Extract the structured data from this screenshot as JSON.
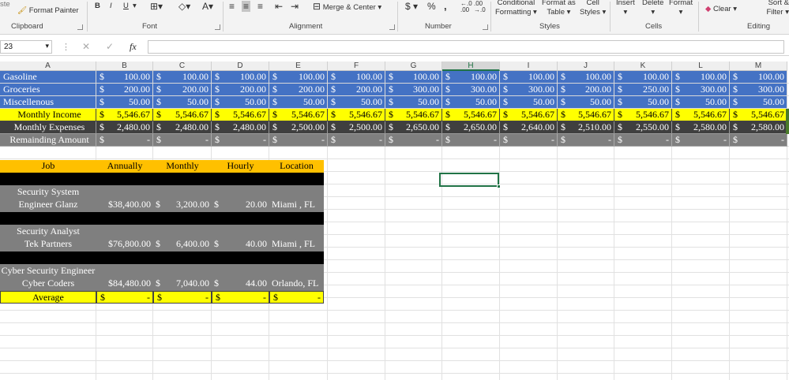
{
  "ribbon": {
    "paste_fragment": "ste",
    "format_painter": "Format Painter",
    "bold": "B",
    "italic": "I",
    "underline": "U",
    "font_color_glyph": "A",
    "merge_center": "Merge & Center",
    "currency": "$",
    "percent": "%",
    "comma": ",",
    "conditional_formatting_1": "Conditional",
    "conditional_formatting_2": "Formatting",
    "format_as_table_1": "Format as",
    "format_as_table_2": "Table",
    "cell_styles_1": "Cell",
    "cell_styles_2": "Styles",
    "insert": "Insert",
    "delete": "Delete",
    "format": "Format",
    "clear": "Clear",
    "sort_filter_1": "Sort &",
    "sort_filter_2": "Filter",
    "groups": {
      "clipboard": "Clipboard",
      "font": "Font",
      "alignment": "Alignment",
      "number": "Number",
      "styles": "Styles",
      "cells": "Cells",
      "editing": "Editing"
    }
  },
  "formula_bar": {
    "name_box": "23",
    "fx": "fx",
    "cancel": "✕",
    "enter": "✓",
    "value": ""
  },
  "columns": [
    "A",
    "B",
    "C",
    "D",
    "E",
    "F",
    "G",
    "H",
    "I",
    "J",
    "K",
    "L",
    "M"
  ],
  "selected_column": "H",
  "budget": {
    "rows": [
      {
        "label": "Gasoline",
        "style": "blue",
        "values": [
          "100.00",
          "100.00",
          "100.00",
          "100.00",
          "100.00",
          "100.00",
          "100.00",
          "100.00",
          "100.00",
          "100.00",
          "100.00",
          "100.00"
        ]
      },
      {
        "label": "Groceries",
        "style": "blue",
        "values": [
          "200.00",
          "200.00",
          "200.00",
          "200.00",
          "200.00",
          "300.00",
          "300.00",
          "300.00",
          "200.00",
          "250.00",
          "300.00",
          "300.00"
        ]
      },
      {
        "label": "Miscellenous",
        "style": "blue",
        "values": [
          "50.00",
          "50.00",
          "50.00",
          "50.00",
          "50.00",
          "50.00",
          "50.00",
          "50.00",
          "50.00",
          "50.00",
          "50.00",
          "50.00"
        ]
      },
      {
        "label": "Monthly Income",
        "style": "yellow",
        "values": [
          "5,546.67",
          "5,546.67",
          "5,546.67",
          "5,546.67",
          "5,546.67",
          "5,546.67",
          "5,546.67",
          "5,546.67",
          "5,546.67",
          "5,546.67",
          "5,546.67",
          "5,546.67"
        ]
      },
      {
        "label": "Monthly Expenses",
        "style": "dgray",
        "values": [
          "2,480.00",
          "2,480.00",
          "2,480.00",
          "2,500.00",
          "2,500.00",
          "2,650.00",
          "2,650.00",
          "2,640.00",
          "2,510.00",
          "2,550.00",
          "2,580.00",
          "2,580.00"
        ]
      },
      {
        "label": "Remainding Amount",
        "style": "mgray",
        "values": [
          "-",
          "-",
          "-",
          "-",
          "-",
          "-",
          "-",
          "-",
          "-",
          "-",
          "-",
          "-"
        ]
      }
    ],
    "currency_symbol": "$"
  },
  "jobs": {
    "headers": [
      "Job",
      "Annually",
      "Monthly",
      "Hourly",
      "Location"
    ],
    "entries": [
      {
        "title_line1": "Security System",
        "title_line2": "Engineer Glanz",
        "annually": "$38,400.00",
        "monthly": "3,200.00",
        "hourly": "20.00",
        "location": "Miami , FL"
      },
      {
        "title_line1": "Security Analyst",
        "title_line2": "Tek Partners",
        "annually": "$76,800.00",
        "monthly": "6,400.00",
        "hourly": "40.00",
        "location": "Miami , FL"
      },
      {
        "title_line1": "Cyber Security Engineer",
        "title_line2": "Cyber Coders",
        "annually": "$84,480.00",
        "monthly": "7,040.00",
        "hourly": "44.00",
        "location": "Orlando, FL"
      }
    ],
    "average_label": "Average",
    "average_values": [
      "-",
      "-",
      "-",
      "-"
    ]
  },
  "colors": {
    "header_blue": "#4472c4",
    "income_yellow": "#ffff00",
    "expenses_dark": "#3f3f3f",
    "remaining_gray": "#7f7f7f",
    "job_header_orange": "#ffc000",
    "excel_green": "#217346"
  }
}
